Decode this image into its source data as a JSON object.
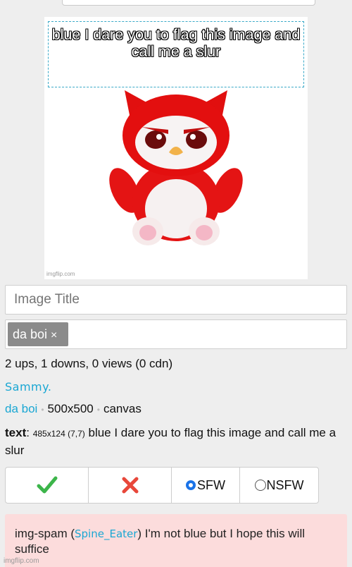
{
  "meme": {
    "caption": "blue I dare you to flag this image and call me a slur",
    "watermark": "imgflip.com"
  },
  "form": {
    "title_placeholder": "Image Title",
    "tags": [
      {
        "label": "da boi",
        "remove": "×"
      }
    ]
  },
  "stats": "2 ups, 1 downs, 0 views (0 cdn)",
  "author": "Sammy.",
  "meta": {
    "tag": "da boi",
    "dimensions": "500x500",
    "template": "canvas"
  },
  "text_layer": {
    "label": "text",
    "colon": ":",
    "dims": "485x124 (7,7)",
    "content": "blue I dare you to flag this image and call me a slur"
  },
  "moderation": {
    "approve_glyph": "✔",
    "reject_glyph": "✖",
    "sfw_label": "SFW",
    "nsfw_label": "NSFW",
    "sfw_selected": true,
    "approve_color": "#3cb54a",
    "reject_color": "#e8473a"
  },
  "comment": {
    "prefix": "img-spam (",
    "user": "Spine_Eater",
    "suffix": ") I'm not blue but I hope this will suffice"
  },
  "footer_watermark": "imgflip.com",
  "icons": {
    "approve": "check-icon",
    "reject": "x-icon",
    "tag_remove": "close-icon"
  }
}
